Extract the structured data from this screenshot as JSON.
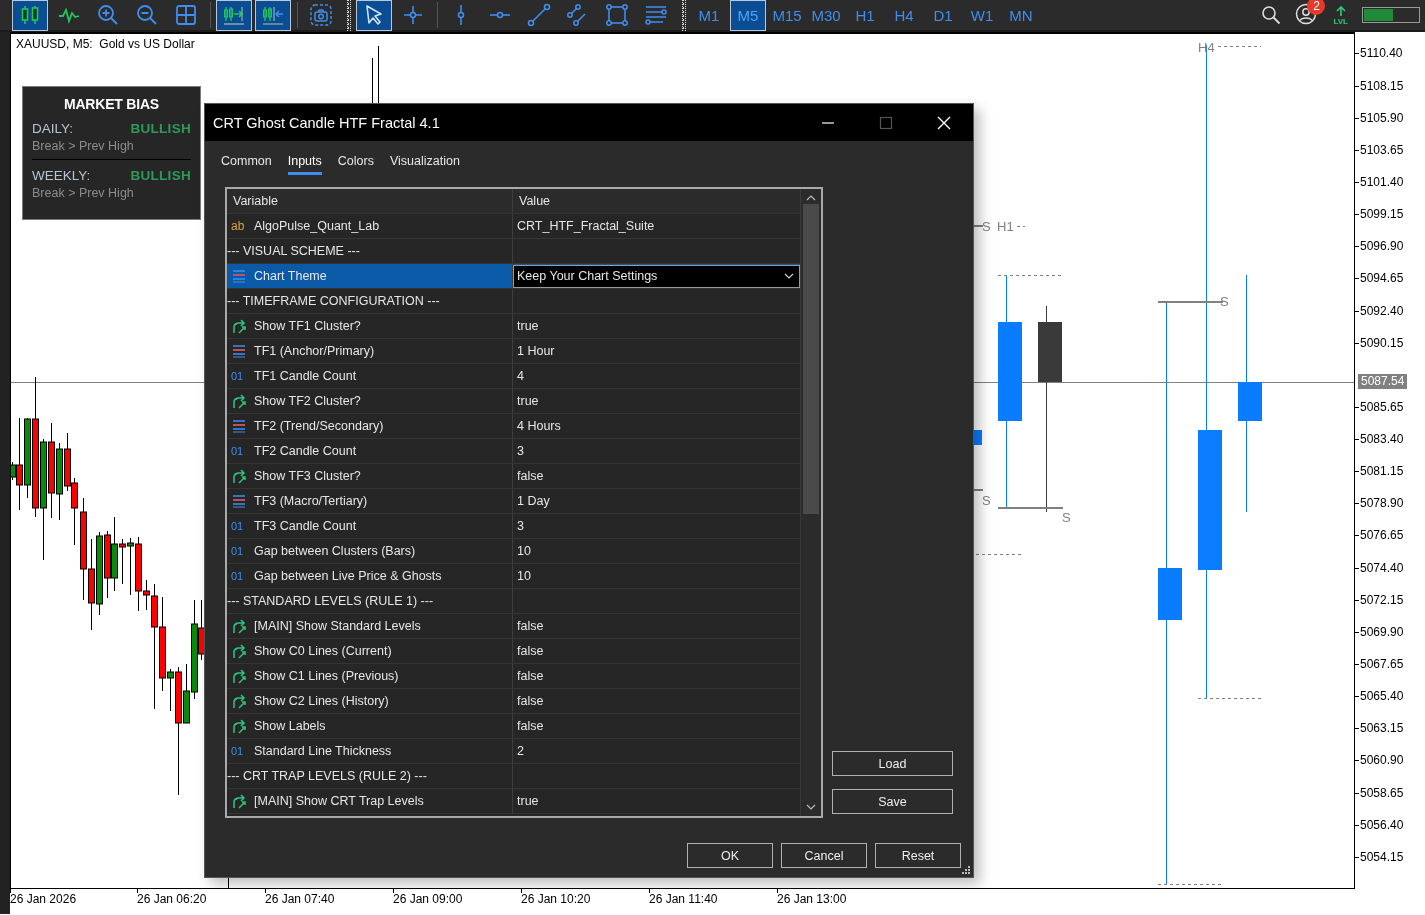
{
  "toolbar": {
    "tool_groups": [
      [
        {
          "kind": "candles",
          "selected": true
        },
        {
          "kind": "line-chart",
          "selected": false
        },
        {
          "kind": "zoom-in",
          "selected": false
        },
        {
          "kind": "zoom-out",
          "selected": false
        },
        {
          "kind": "grid",
          "selected": false
        }
      ],
      [
        {
          "kind": "autoscroll",
          "selected": true
        },
        {
          "kind": "chart-shift",
          "selected": true
        }
      ],
      [
        {
          "kind": "screenshot",
          "selected": false
        }
      ],
      [
        {
          "kind": "cursor",
          "selected": true
        },
        {
          "kind": "crosshair",
          "selected": false
        }
      ],
      [
        {
          "kind": "vertical-line",
          "selected": false
        },
        {
          "kind": "horizontal-line",
          "selected": false
        },
        {
          "kind": "trendline",
          "selected": false
        },
        {
          "kind": "channel",
          "selected": false
        },
        {
          "kind": "rectangle",
          "selected": false
        },
        {
          "kind": "fibonacci",
          "selected": false
        }
      ]
    ],
    "timeframes": [
      {
        "label": "M1",
        "selected": false
      },
      {
        "label": "M5",
        "selected": true
      },
      {
        "label": "M15",
        "selected": false
      },
      {
        "label": "M30",
        "selected": false
      },
      {
        "label": "H1",
        "selected": false
      },
      {
        "label": "H4",
        "selected": false
      },
      {
        "label": "D1",
        "selected": false
      },
      {
        "label": "W1",
        "selected": false
      },
      {
        "label": "MN",
        "selected": false
      }
    ],
    "badge": "2",
    "lvl_label": "LVL",
    "meter": {
      "level": 0.53
    }
  },
  "chart": {
    "title": "XAUUSD, M5:  Gold vs US Dollar",
    "marks": [
      {
        "text": "S"
      },
      {
        "text": "H1"
      },
      {
        "text": "S"
      },
      {
        "text": "S"
      },
      {
        "text": "S"
      },
      {
        "text": "H4"
      }
    ],
    "price_labels": [
      "5110.40",
      "5108.15",
      "5105.90",
      "5103.65",
      "5101.40",
      "5099.15",
      "5096.90",
      "5094.65",
      "5092.40",
      "5090.15",
      "5085.65",
      "5083.40",
      "5081.15",
      "5078.90",
      "5076.65",
      "5074.40",
      "5072.15",
      "5069.90",
      "5067.65",
      "5065.40",
      "5063.15",
      "5060.90",
      "5058.65",
      "5056.40",
      "5054.15"
    ],
    "current_price": "5087.54",
    "time_labels": [
      "26 Jan 2026",
      "26 Jan 06:20",
      "26 Jan 07:40",
      "26 Jan 09:00",
      "26 Jan 10:20",
      "26 Jan 11:40",
      "26 Jan 13:00"
    ]
  },
  "market_bias": {
    "title": "MARKET BIAS",
    "rows": [
      {
        "label": "DAILY:",
        "value": "BULLISH",
        "color": "#2e9a5a",
        "note": "Break > Prev High"
      },
      {
        "label": "WEEKLY:",
        "value": "BULLISH",
        "color": "#2e9a5a",
        "note": "Break > Prev High"
      }
    ]
  },
  "dialog": {
    "title": "CRT Ghost Candle HTF Fractal 4.1",
    "tabs": [
      {
        "label": "Common",
        "selected": false
      },
      {
        "label": "Inputs",
        "selected": true
      },
      {
        "label": "Colors",
        "selected": false
      },
      {
        "label": "Visualization",
        "selected": false
      }
    ],
    "columns": [
      "Variable",
      "Value"
    ],
    "rows": [
      {
        "kind": "string",
        "type_mark": "ab",
        "variable": "AlgoPulse_Quant_Lab",
        "value": "CRT_HTF_Fractal_Suite",
        "selected": false
      },
      {
        "kind": "group",
        "variable": "--- VISUAL SCHEME ---",
        "selected": false
      },
      {
        "kind": "enum",
        "variable": "Chart Theme",
        "value": "Keep Your Chart Settings",
        "selected": true
      },
      {
        "kind": "group",
        "variable": "--- TIMEFRAME CONFIGURATION ---",
        "selected": false
      },
      {
        "kind": "bool",
        "variable": "Show TF1 Cluster?",
        "value": "true",
        "selected": false
      },
      {
        "kind": "enum",
        "variable": "TF1 (Anchor/Primary)",
        "value": "1 Hour",
        "selected": false
      },
      {
        "kind": "int",
        "type_mark": "01",
        "variable": "TF1 Candle Count",
        "value": "4",
        "selected": false
      },
      {
        "kind": "bool",
        "variable": "Show TF2 Cluster?",
        "value": "true",
        "selected": false
      },
      {
        "kind": "enum",
        "variable": "TF2 (Trend/Secondary)",
        "value": "4 Hours",
        "selected": false
      },
      {
        "kind": "int",
        "type_mark": "01",
        "variable": "TF2 Candle Count",
        "value": "3",
        "selected": false
      },
      {
        "kind": "bool",
        "variable": "Show TF3 Cluster?",
        "value": "false",
        "selected": false
      },
      {
        "kind": "enum",
        "variable": "TF3 (Macro/Tertiary)",
        "value": "1 Day",
        "selected": false
      },
      {
        "kind": "int",
        "type_mark": "01",
        "variable": "TF3 Candle Count",
        "value": "3",
        "selected": false
      },
      {
        "kind": "int",
        "type_mark": "01",
        "variable": "Gap between Clusters (Bars)",
        "value": "10",
        "selected": false
      },
      {
        "kind": "int",
        "type_mark": "01",
        "variable": "Gap between Live Price & Ghosts",
        "value": "10",
        "selected": false
      },
      {
        "kind": "group",
        "variable": "--- STANDARD LEVELS (RULE 1) ---",
        "selected": false
      },
      {
        "kind": "bool",
        "variable": "[MAIN] Show Standard Levels",
        "value": "false",
        "selected": false
      },
      {
        "kind": "bool",
        "variable": "Show C0 Lines (Current)",
        "value": "false",
        "selected": false
      },
      {
        "kind": "bool",
        "variable": "Show C1 Lines (Previous)",
        "value": "false",
        "selected": false
      },
      {
        "kind": "bool",
        "variable": "Show C2 Lines (History)",
        "value": "false",
        "selected": false
      },
      {
        "kind": "bool",
        "variable": "Show Labels",
        "value": "false",
        "selected": false
      },
      {
        "kind": "int",
        "type_mark": "01",
        "variable": "Standard Line Thickness",
        "value": "2",
        "selected": false
      },
      {
        "kind": "group",
        "variable": "--- CRT TRAP LEVELS (RULE 2) ---",
        "selected": false
      },
      {
        "kind": "bool",
        "variable": "[MAIN] Show CRT Trap Levels",
        "value": "true",
        "selected": false
      }
    ],
    "side_buttons": [
      "Load",
      "Save"
    ],
    "buttons": [
      "OK",
      "Cancel",
      "Reset"
    ]
  }
}
